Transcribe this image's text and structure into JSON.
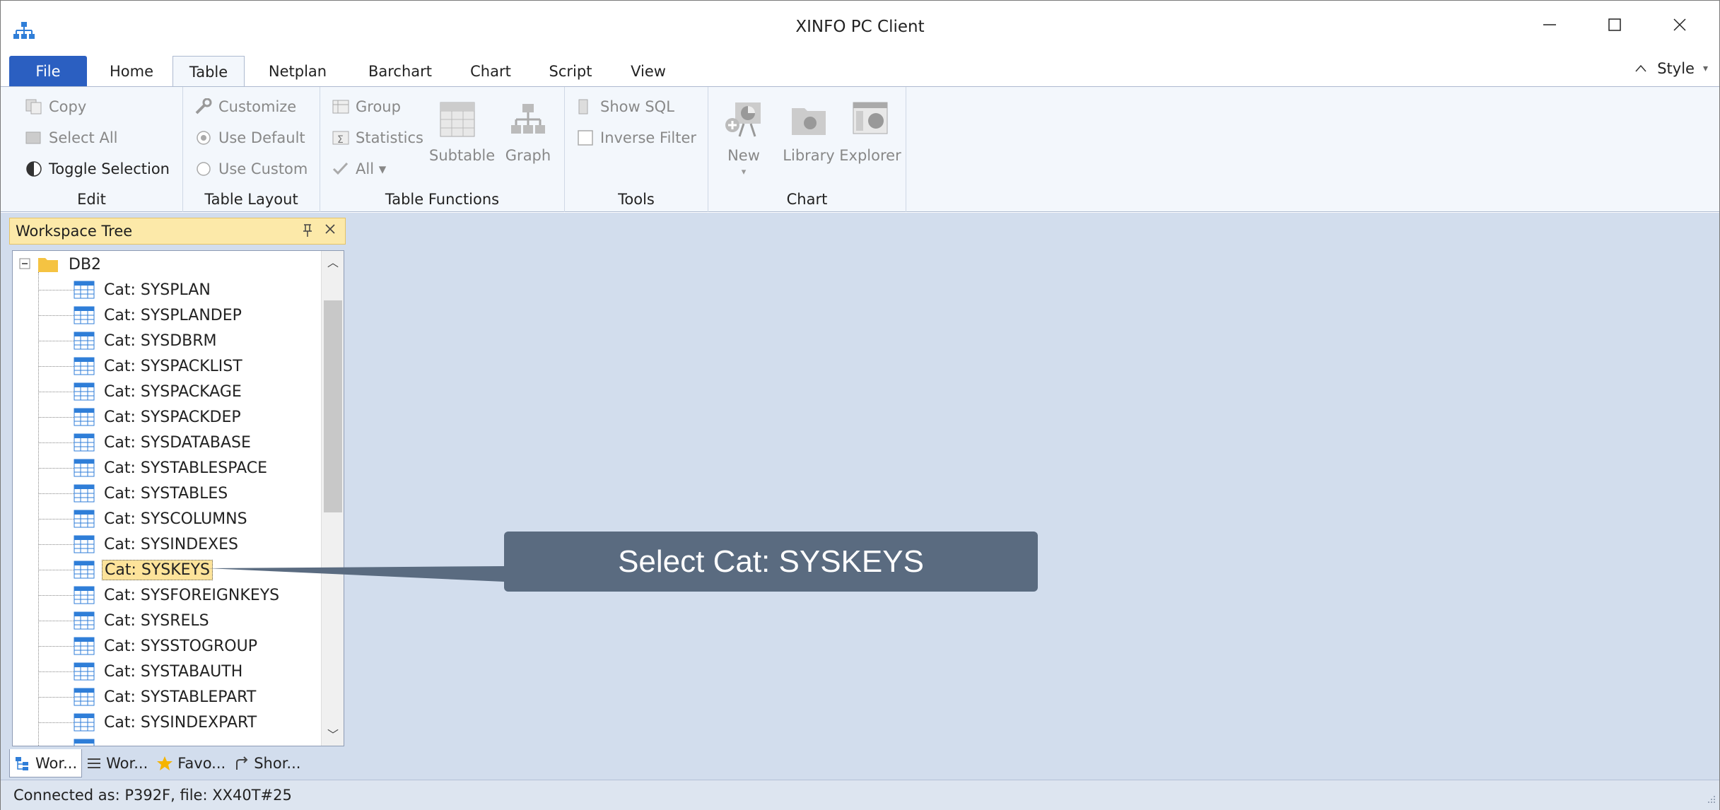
{
  "window": {
    "title": "XINFO PC Client",
    "controls": {
      "minimize": "—",
      "maximize": "☐",
      "close": "✕"
    }
  },
  "ribbon": {
    "tabs": [
      {
        "label": "File"
      },
      {
        "label": "Home"
      },
      {
        "label": "Table",
        "active": true
      },
      {
        "label": "Netplan"
      },
      {
        "label": "Barchart"
      },
      {
        "label": "Chart"
      },
      {
        "label": "Script"
      },
      {
        "label": "View"
      }
    ],
    "style_label": "Style",
    "groups": {
      "edit": {
        "label": "Edit",
        "copy": "Copy",
        "select_all": "Select All",
        "toggle_selection": "Toggle Selection"
      },
      "table_layout": {
        "label": "Table Layout",
        "customize": "Customize",
        "use_default": "Use Default",
        "use_custom": "Use Custom"
      },
      "table_functions": {
        "label": "Table Functions",
        "group": "Group",
        "statistics": "Statistics",
        "all": "All ▾",
        "subtable": "Subtable",
        "graph": "Graph"
      },
      "tools": {
        "label": "Tools",
        "show_sql": "Show SQL",
        "inverse_filter": "Inverse Filter"
      },
      "chart": {
        "label": "Chart",
        "new": "New",
        "library": "Library",
        "explorer": "Explorer"
      }
    }
  },
  "workspace_panel": {
    "title": "Workspace Tree",
    "pin": "ᵖ",
    "close": "✕",
    "root": "DB2",
    "items": [
      "Cat: SYSPLAN",
      "Cat: SYSPLANDEP",
      "Cat: SYSDBRM",
      "Cat: SYSPACKLIST",
      "Cat: SYSPACKAGE",
      "Cat: SYSPACKDEP",
      "Cat: SYSDATABASE",
      "Cat: SYSTABLESPACE",
      "Cat: SYSTABLES",
      "Cat: SYSCOLUMNS",
      "Cat: SYSINDEXES",
      "Cat: SYSKEYS",
      "Cat: SYSFOREIGNKEYS",
      "Cat: SYSRELS",
      "Cat: SYSSTOGROUP",
      "Cat: SYSTABAUTH",
      "Cat: SYSTABLEPART",
      "Cat: SYSINDEXPART"
    ],
    "selected_item": "Cat: SYSKEYS",
    "bottom_tabs": [
      "Wor...",
      "Wor...",
      "Favo...",
      "Shor..."
    ]
  },
  "callout": {
    "text": "Select Cat: SYSKEYS"
  },
  "status": {
    "text": "Connected as: P392F, file: XX40T#25"
  },
  "colors": {
    "file_tab": "#2b5fc1",
    "panel_header": "#fce9a9",
    "workspace_bg": "#d2dded",
    "callout_bg": "#5a6b80",
    "selection": "#fde39a"
  }
}
